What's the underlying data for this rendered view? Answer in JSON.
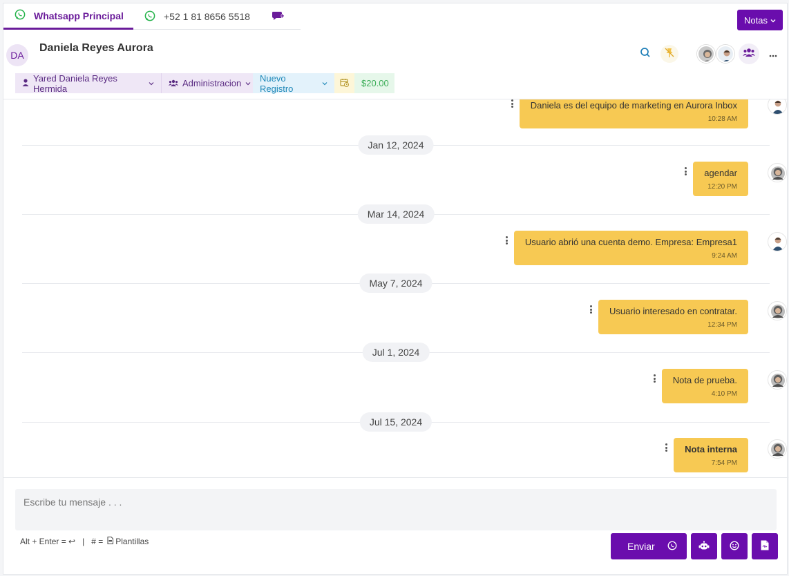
{
  "tabs": [
    {
      "label": "Whatsapp Principal"
    },
    {
      "label": "+52 1 81 8656 5518"
    }
  ],
  "notes_button": {
    "label": "Notas"
  },
  "contact": {
    "initials": "DA",
    "name": "Daniela Reyes Aurora"
  },
  "tags": {
    "assignee": "Yared Daniela Reyes Hermida",
    "team": "Administracion",
    "stage": "Nuevo Registro",
    "amount": "$20.00"
  },
  "messages": [
    {
      "date": "",
      "text": "Daniela es del equipo de marketing en Aurora Inbox",
      "time": "10:28 AM",
      "avatar": "man-avatar"
    },
    {
      "date": "Jan 12, 2024",
      "text": "agendar",
      "time": "12:20 PM",
      "avatar": "woman-avatar"
    },
    {
      "date": "Mar 14, 2024",
      "text": "Usuario abrió una cuenta demo. Empresa: Empresa1",
      "time": "9:24 AM",
      "avatar": "man-avatar"
    },
    {
      "date": "May 7, 2024",
      "text": "Usuario interesado en contratar.",
      "time": "12:34 PM",
      "avatar": "woman-avatar"
    },
    {
      "date": "Jul 1, 2024",
      "text": "Nota de prueba.",
      "time": "4:10 PM",
      "avatar": "woman-avatar"
    },
    {
      "date": "Jul 15, 2024",
      "text": "Nota interna",
      "time": "7:54 PM",
      "avatar": "woman-avatar"
    }
  ],
  "composer": {
    "placeholder": "Escribe tu mensaje . . .",
    "hint_enter": "Alt + Enter = ↩",
    "hint_sep": "|",
    "hint_templates_prefix": "# =",
    "hint_templates": "Plantillas",
    "send_label": "Enviar"
  },
  "colors": {
    "accent": "#6a0dad",
    "bubble": "#f7c953",
    "whatsapp": "#25b34b",
    "amount": "#3dae59",
    "stage": "#1f88b8"
  }
}
